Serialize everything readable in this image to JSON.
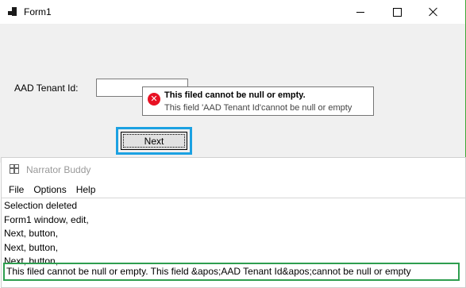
{
  "form": {
    "title": "Form1",
    "tenant_label": "AAD Tenant Id:",
    "tenant_value": "",
    "error_icon": "error-icon",
    "error_title": "This filed cannot be null or empty.",
    "error_body": "This field 'AAD Tenant Id'cannot be null or empty",
    "next_label": "Next"
  },
  "narrator": {
    "title": "Narrator Buddy",
    "menu": [
      "File",
      "Options",
      "Help"
    ],
    "log": [
      "Selection deleted",
      "Form1 window, edit,",
      "Next, button,",
      "Next, button,",
      "Next, button,"
    ],
    "highlighted_line": "This filed cannot be null or empty. This field &apos;AAD Tenant Id&apos;cannot be null or empty"
  },
  "colors": {
    "focus_frame": "#1ba1e2",
    "highlight_frame": "#2e9e4f",
    "error_red": "#e81123"
  }
}
